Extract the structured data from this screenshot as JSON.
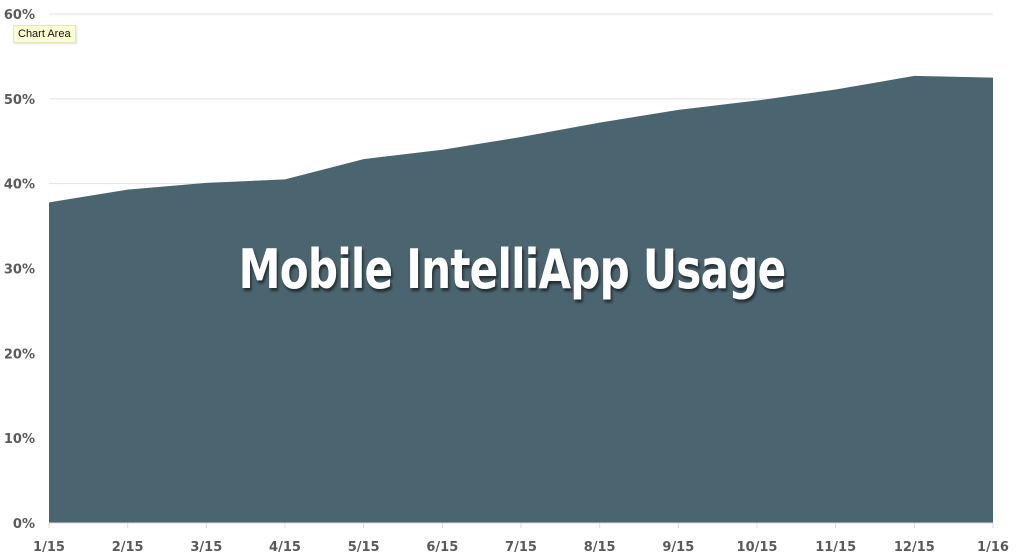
{
  "chart_data": {
    "type": "area",
    "title": "Mobile IntelliApp Usage",
    "xlabel": "",
    "ylabel": "",
    "categories": [
      "1/15",
      "2/15",
      "3/15",
      "4/15",
      "5/15",
      "6/15",
      "7/15",
      "8/15",
      "9/15",
      "10/15",
      "11/15",
      "12/15",
      "1/16"
    ],
    "series": [
      {
        "name": "Mobile IntelliApp Usage",
        "values": [
          37.8,
          39.3,
          40.1,
          40.5,
          42.9,
          44.0,
          45.5,
          47.2,
          48.7,
          49.8,
          51.1,
          52.7,
          52.5
        ],
        "color": "#4b6570"
      }
    ],
    "ylim": [
      0,
      60
    ],
    "yticks": [
      0,
      10,
      20,
      30,
      40,
      50,
      60
    ],
    "ytick_labels": [
      "0%",
      "10%",
      "20%",
      "30%",
      "40%",
      "50%",
      "60%"
    ],
    "grid": true,
    "legend": "none"
  },
  "tooltip": {
    "text": "Chart Area"
  },
  "colors": {
    "area": "#4b6570",
    "grid": "#e3e3e3",
    "tick_text": "#5a5a5a",
    "title_text": "#ffffff"
  }
}
